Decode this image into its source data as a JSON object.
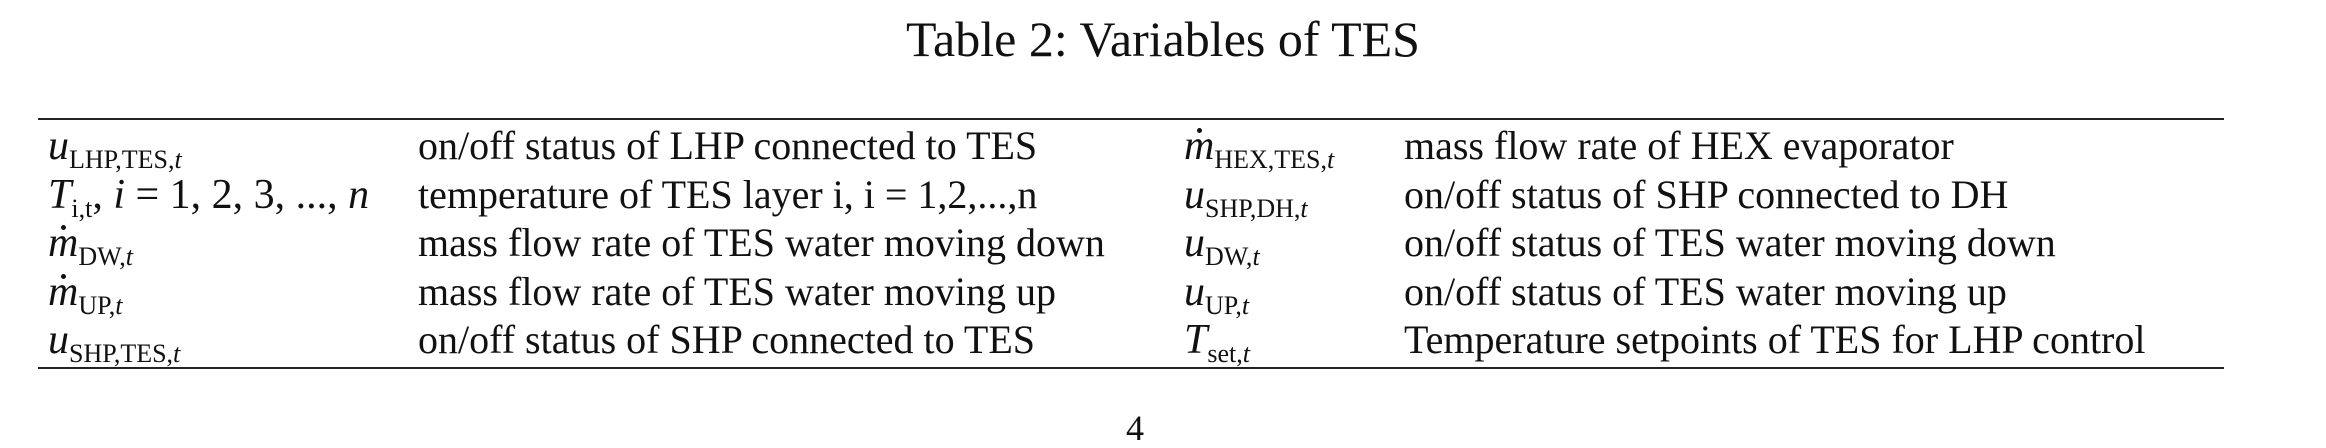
{
  "caption": "Table 2: Variables of TES",
  "rows": [
    {
      "sym1": "u",
      "sub1": "LHP,TES,",
      "desc1": "on/off status of LHP connected to TES",
      "sym2": "m",
      "sub2": "HEX,TES,",
      "desc2": "mass flow rate of HEX evaporator"
    },
    {
      "sym1": "T",
      "desc1": "temperature of TES layer i, i = 1,2,...,n",
      "sym2": "u",
      "sub2": "SHP,DH,",
      "desc2": "on/off status of SHP connected to DH"
    },
    {
      "sym1": "m",
      "sub1": "DW,",
      "desc1": "mass flow rate of TES water moving down",
      "sym2": "u",
      "sub2": "DW,",
      "desc2": "on/off status of TES water moving down"
    },
    {
      "sym1": "m",
      "sub1": "UP,",
      "desc1": "mass flow rate of TES water moving up",
      "sym2": "u",
      "sub2": "UP,",
      "desc2": "on/off status of TES water moving up"
    },
    {
      "sym1": "u",
      "sub1": "SHP,TES,",
      "desc1": "on/off status of SHP connected to TES",
      "sym2": "T",
      "sub2": "set,",
      "desc2": "Temperature setpoints of TES for LHP control"
    }
  ],
  "row2_symbol": {
    "sub": "i,t",
    "sep": ", ",
    "index": "i",
    "eq": " = 1, 2, 3, ..., ",
    "upper": "n"
  },
  "time_index": "t",
  "page_number": "4"
}
